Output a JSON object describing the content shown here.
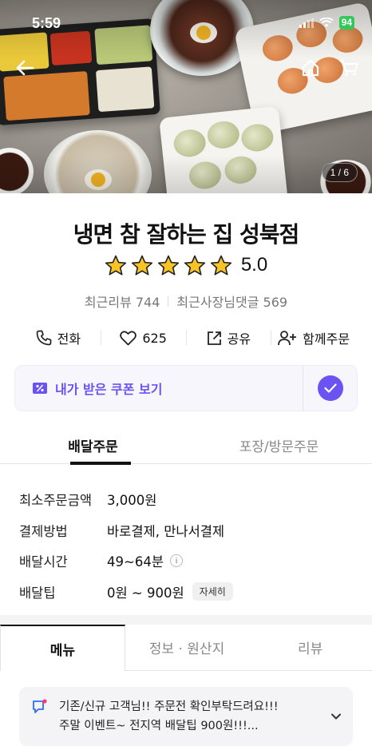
{
  "status_bar": {
    "time": "5:59",
    "battery": "94"
  },
  "hero": {
    "page_indicator": "1 / 6"
  },
  "store": {
    "name": "냉면 참 잘하는 집 성북점",
    "rating": "5.0",
    "stars": 5,
    "recent_reviews": "최근리뷰 744",
    "owner_replies": "최근사장님댓글 569"
  },
  "actions": {
    "call": "전화",
    "likes": "625",
    "share": "공유",
    "group_order": "함께주문"
  },
  "coupon": {
    "label": "내가 받은 쿠폰 보기"
  },
  "order_tabs": {
    "delivery": "배달주문",
    "pickup": "포장/방문주문"
  },
  "delivery_info": [
    {
      "label": "최소주문금액",
      "value": "3,000원"
    },
    {
      "label": "결제방법",
      "value": "바로결제, 만나서결제"
    },
    {
      "label": "배달시간",
      "value": "49~64분"
    },
    {
      "label": "배달팁",
      "value": "0원 ~ 900원",
      "chip": "자세히"
    }
  ],
  "content_tabs": {
    "menu": "메뉴",
    "info": "정보 · 원산지",
    "review": "리뷰"
  },
  "notice": {
    "line1": "기존/신규 고객님!! 주문전 확인부탁드려요!!!",
    "line2": "주말 이벤트~ 전지역 배달팁 900원!!!..."
  },
  "colors": {
    "accent": "#6b52f2",
    "star": "#f7c325",
    "battery": "#34c759"
  },
  "icons": [
    "back-arrow-icon",
    "home-icon",
    "cart-icon",
    "signal-icon",
    "wifi-icon",
    "phone-icon",
    "heart-icon",
    "share-icon",
    "add-person-icon",
    "coupon-icon",
    "check-icon",
    "info-icon",
    "notice-icon",
    "chevron-down-icon"
  ]
}
